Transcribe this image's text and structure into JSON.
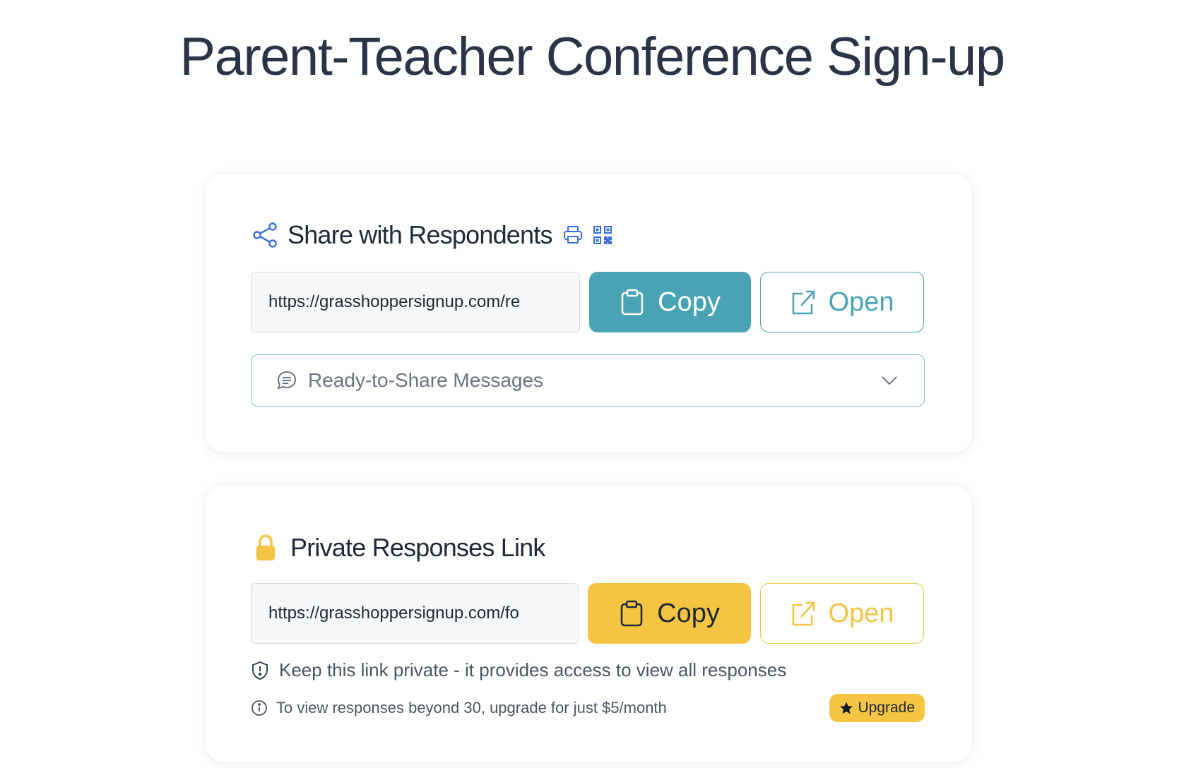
{
  "page": {
    "title": "Parent-Teacher Conference Sign-up"
  },
  "share_card": {
    "title": "Share with Respondents",
    "link_value": "https://grasshoppersignup.com/re",
    "copy_label": "Copy",
    "open_label": "Open",
    "messages_label": "Ready-to-Share Messages"
  },
  "private_card": {
    "title": "Private Responses Link",
    "link_value": "https://grasshoppersignup.com/fo",
    "copy_label": "Copy",
    "open_label": "Open",
    "privacy_note": "Keep this link private - it provides access to view all responses",
    "upgrade_note": "To view responses beyond 30, upgrade for just $5/month",
    "upgrade_label": "Upgrade"
  },
  "icons": {
    "share": "share-icon",
    "print": "printer-icon",
    "qr": "qr-code-icon",
    "clipboard": "clipboard-icon",
    "external": "external-link-icon",
    "chat": "chat-bubble-icon",
    "chevron": "chevron-down-icon",
    "lock": "lock-icon",
    "shield": "shield-alert-icon",
    "info": "info-icon",
    "star": "star-icon"
  },
  "colors": {
    "teal": "#4aa3b5",
    "yellow": "#f5c443",
    "blue_icon": "#3b6fd8",
    "title_text": "#2b3447",
    "muted_text": "#6b7280"
  }
}
